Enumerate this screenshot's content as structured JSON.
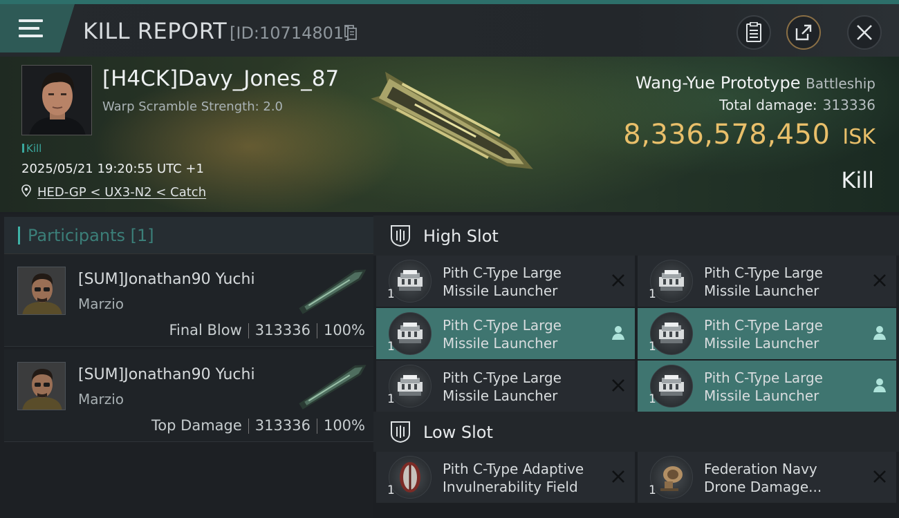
{
  "header": {
    "title": "KILL REPORT",
    "report_id": "[ID:10714801]"
  },
  "victim": {
    "name": "[H4CK]Davy_Jones_87",
    "warp_scramble": "Warp Scramble Strength: 2.0",
    "kill_tag": "Kill",
    "date": "2025/05/21 19:20:55 UTC +1",
    "location": "HED-GP < UX3-N2 < Catch"
  },
  "ship": {
    "name": "Wang-Yue Prototype",
    "class": "Battleship",
    "total_damage_label": "Total damage:",
    "total_damage": "313336",
    "isk_value": "8,336,578,450",
    "isk_unit": "ISK",
    "result": "Kill"
  },
  "participants": {
    "label": "Participants [1]",
    "rows": [
      {
        "name": "[SUM]Jonathan90 Yuchi",
        "ship": "Marzio",
        "role": "Final Blow",
        "damage": "313336",
        "percent": "100%"
      },
      {
        "name": "[SUM]Jonathan90 Yuchi",
        "ship": "Marzio",
        "role": "Top Damage",
        "damage": "313336",
        "percent": "100%"
      }
    ]
  },
  "high_slot": {
    "label": "High Slot",
    "items": [
      {
        "name": "Pith C-Type Large Missile Launcher",
        "qty": "1",
        "status": "destroyed"
      },
      {
        "name": "Pith C-Type Large Missile Launcher",
        "qty": "1",
        "status": "destroyed"
      },
      {
        "name": "Pith C-Type Large Missile Launcher",
        "qty": "1",
        "status": "dropped"
      },
      {
        "name": "Pith C-Type Large Missile Launcher",
        "qty": "1",
        "status": "dropped"
      },
      {
        "name": "Pith C-Type Large Missile Launcher",
        "qty": "1",
        "status": "destroyed"
      },
      {
        "name": "Pith C-Type Large Missile Launcher",
        "qty": "1",
        "status": "dropped"
      }
    ]
  },
  "low_slot": {
    "label": "Low Slot",
    "items": [
      {
        "name": "Pith C-Type Adaptive Invulnerability Field",
        "qty": "1",
        "status": "destroyed"
      },
      {
        "name": "Federation Navy Drone Damage...",
        "qty": "1",
        "status": "destroyed"
      }
    ]
  },
  "colors": {
    "accent": "#3fb3a7",
    "isk": "#e9bf6a",
    "active_row": "#3f7570"
  }
}
